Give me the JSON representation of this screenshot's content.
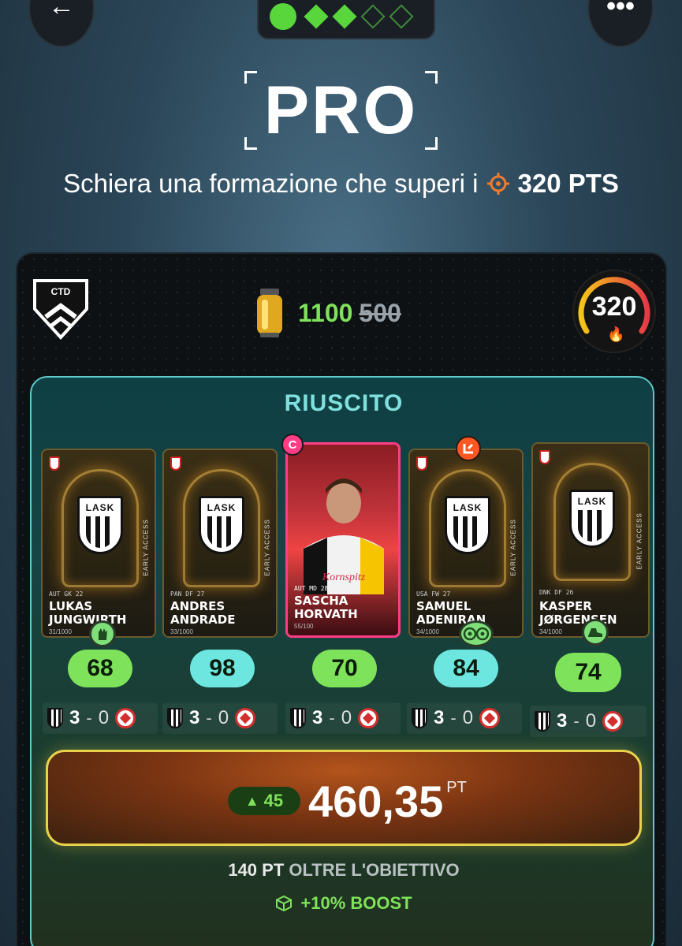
{
  "header": {
    "back_icon": "back-arrow-icon",
    "more_icon": "more-dots-icon",
    "progress": {
      "completed": 1,
      "steps": 5,
      "accent": "#58d63c"
    }
  },
  "tier": {
    "title": "PRO",
    "subtitle_text": "Schiera una formazione che superi i",
    "target_points": "320 PTS"
  },
  "panel": {
    "badge_text": "CTD",
    "reward_new": "1100",
    "reward_old": "500",
    "gauge_value": "320",
    "status_title": "RIUSCITO",
    "players": [
      {
        "name_line1": "LUKAS",
        "name_line2": "JUNGWIRTH",
        "meta": "AUT  GK  22",
        "serial": "31/1000",
        "club": "LASK",
        "score": "68",
        "score_color": "green",
        "home": "3",
        "away": "0",
        "badge": "goalkeeper-glove-icon"
      },
      {
        "name_line1": "ANDRES",
        "name_line2": "ANDRADE",
        "meta": "PAN  DF  27",
        "serial": "33/1000",
        "club": "LASK",
        "score": "98",
        "score_color": "cyan",
        "home": "3",
        "away": "0",
        "badge": ""
      },
      {
        "name_line1": "SASCHA",
        "name_line2": "HORVATH",
        "meta": "AUT  MD  28",
        "serial": "55/100",
        "club": "LASK",
        "score": "70",
        "score_color": "green",
        "home": "3",
        "away": "0",
        "badge": "captain",
        "captain_label": "C"
      },
      {
        "name_line1": "SAMUEL",
        "name_line2": "ADENIRAN",
        "meta": "USA  FW  27",
        "serial": "34/1000",
        "club": "LASK",
        "score": "84",
        "score_color": "cyan",
        "home": "3",
        "away": "0",
        "badge": "double-ball-icon"
      },
      {
        "name_line1": "KASPER",
        "name_line2": "JØRGENSEN",
        "meta": "DNK  DF  26",
        "serial": "34/1000",
        "club": "LASK",
        "score": "74",
        "score_color": "green",
        "home": "3",
        "away": "0",
        "badge": "boot-icon"
      }
    ],
    "card_side_text": "EARLY ACCESS",
    "delta": "45",
    "total": "460,35",
    "total_unit": "PT",
    "over_target_value": "140 PT",
    "over_target_label": "OLTRE L'OBIETTIVO",
    "boost": "+10% BOOST",
    "colors": {
      "green": "#7ee25a",
      "cyan": "#6ee6e0",
      "gold_border": "#e9d24a",
      "captain": "#ff3d86"
    }
  }
}
